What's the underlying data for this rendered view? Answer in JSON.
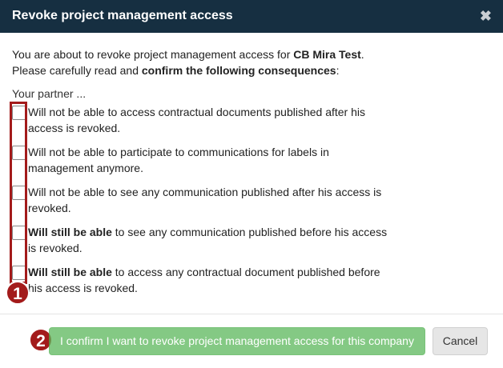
{
  "dialog": {
    "title": "Revoke project management access",
    "close_glyph": "✖"
  },
  "intro": {
    "line1_prefix": "You are about to revoke project management access for ",
    "company_name": "CB Mira Test",
    "line1_suffix": ".",
    "line2_prefix": "Please carefully read and ",
    "line2_bold": "confirm the following consequences",
    "line2_suffix": ":"
  },
  "partner_label": "Your partner ...",
  "consequences": [
    {
      "bold": "",
      "text": "Will not be able to access contractual documents published after his access is revoked.",
      "checked": false
    },
    {
      "bold": "",
      "text": "Will not be able to participate to communications for labels in management anymore.",
      "checked": false
    },
    {
      "bold": "",
      "text": "Will not be able to see any communication published after his access is revoked.",
      "checked": false
    },
    {
      "bold": "Will still be able",
      "text": " to see any communication published before his access is revoked.",
      "checked": false
    },
    {
      "bold": "Will still be able",
      "text": " to access any contractual document published before his access is revoked.",
      "checked": false
    }
  ],
  "annotations": {
    "badge1": "1",
    "badge2": "2",
    "highlight_color": "#a31b1b"
  },
  "footer": {
    "confirm_label": "I confirm I want to revoke project management access for this company",
    "cancel_label": "Cancel"
  },
  "colors": {
    "header_bg": "#162f41",
    "confirm_bg": "#5cb85c",
    "cancel_bg": "#e6e6e6"
  }
}
